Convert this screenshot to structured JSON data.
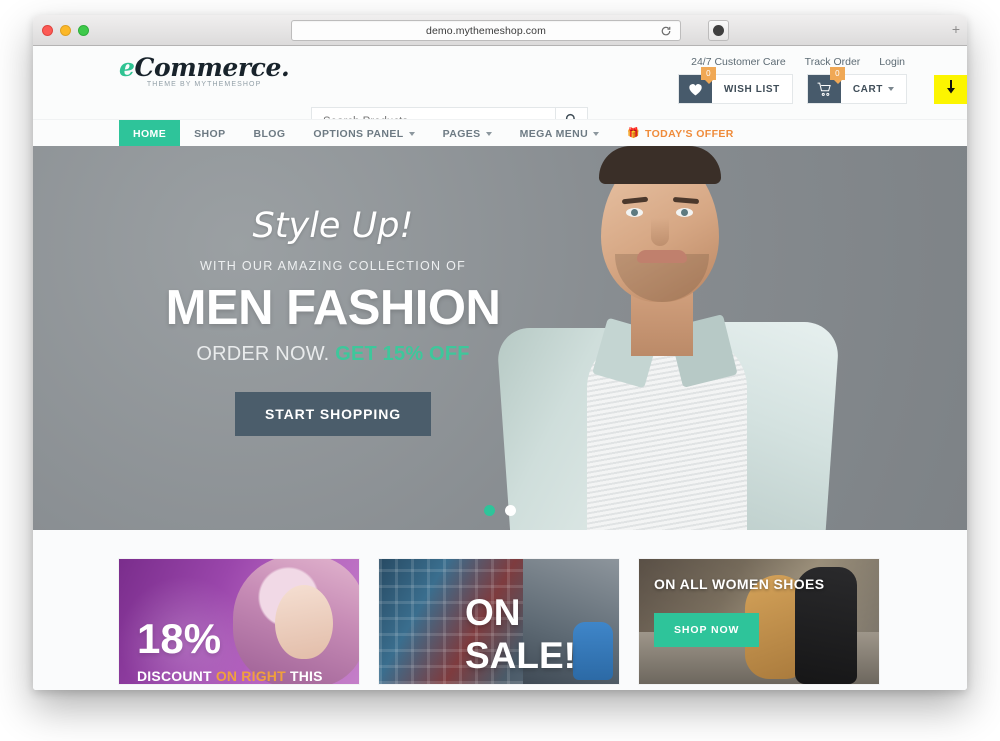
{
  "browser": {
    "url": "demo.mythemeshop.com",
    "reload_icon": "reload-icon",
    "extension_icon": "dark-circle-icon",
    "new_tab_label": "+",
    "download_indicator_icon": "download-arrow-icon"
  },
  "header": {
    "logo": {
      "first_letter": "e",
      "rest": "Commerce.",
      "tagline": "THEME BY MYTHEMESHOP"
    },
    "search": {
      "placeholder": "Search Products...",
      "icon": "search-icon",
      "value": ""
    },
    "util_links": [
      {
        "label": "24/7 Customer Care"
      },
      {
        "label": "Track Order"
      },
      {
        "label": "Login"
      }
    ],
    "wishlist": {
      "label": "WISH LIST",
      "badge": "0",
      "icon": "heart-icon"
    },
    "cart": {
      "label": "CART",
      "badge": "0",
      "icon": "cart-icon",
      "caret": "chevron-down-icon"
    }
  },
  "nav": {
    "items": [
      {
        "label": "HOME",
        "active": true,
        "caret": false,
        "gift": false
      },
      {
        "label": "SHOP",
        "active": false,
        "caret": false,
        "gift": false
      },
      {
        "label": "BLOG",
        "active": false,
        "caret": false,
        "gift": false
      },
      {
        "label": "OPTIONS PANEL",
        "active": false,
        "caret": true,
        "gift": false
      },
      {
        "label": "PAGES",
        "active": false,
        "caret": true,
        "gift": false
      },
      {
        "label": "MEGA MENU",
        "active": false,
        "caret": true,
        "gift": false
      },
      {
        "label": "TODAY'S OFFER",
        "active": false,
        "caret": false,
        "gift": true
      }
    ]
  },
  "hero": {
    "script_line": "Style Up!",
    "sub_line": "WITH OUR AMAZING COLLECTION OF",
    "title": "MEN FASHION",
    "order_prefix": "ORDER NOW. ",
    "order_accent": "GET 15% OFF",
    "cta_label": "START SHOPPING",
    "dots": [
      {
        "active": true
      },
      {
        "active": false
      }
    ]
  },
  "promos": [
    {
      "name": "discount-card",
      "number": "18%",
      "caption_prefix": "DISCOUNT ",
      "caption_highlight": "ON RIGHT",
      "caption_suffix": " THIS"
    },
    {
      "name": "on-sale-card",
      "line1": "ON",
      "line2": "SALE!"
    },
    {
      "name": "women-shoes-card",
      "title": "ON ALL WOMEN SHOES",
      "button_label": "SHOP NOW"
    }
  ],
  "colors": {
    "accent_teal": "#2ec49a",
    "offer_orange": "#ef8b3a",
    "badge_orange": "#f0a855",
    "slate": "#475a6b",
    "download_yellow": "#fcf500"
  }
}
